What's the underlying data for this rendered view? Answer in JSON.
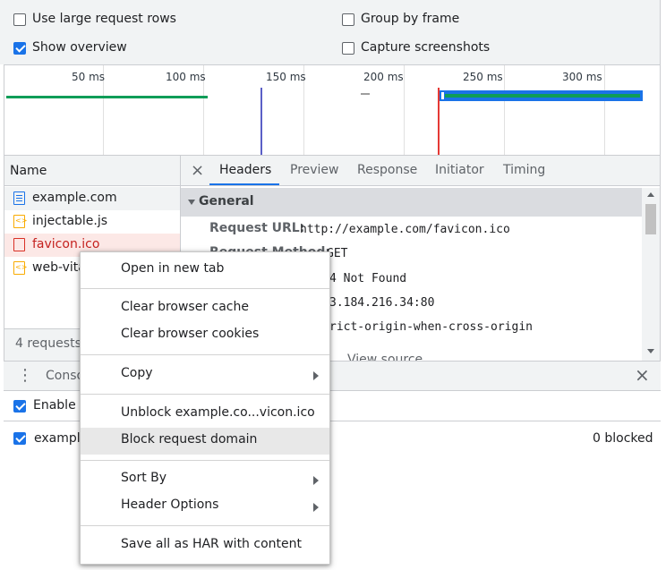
{
  "options": {
    "large_rows": "Use large request rows",
    "group_by_frame": "Group by frame",
    "show_overview": "Show overview",
    "capture_screenshots": "Capture screenshots"
  },
  "overview": {
    "ticks": [
      "50 ms",
      "100 ms",
      "150 ms",
      "200 ms",
      "250 ms",
      "300 ms"
    ]
  },
  "requests": {
    "header": "Name",
    "items": [
      "example.com",
      "injectable.js",
      "favicon.ico",
      "web-vita"
    ],
    "footer": "4 requests"
  },
  "detail": {
    "close": "×",
    "tabs": [
      "Headers",
      "Preview",
      "Response",
      "Initiator",
      "Timing"
    ],
    "general": "General",
    "request_url_key": "Request URL:",
    "request_url": "http://example.com/favicon.ico",
    "request_method_key": "Request Method:",
    "request_method": "GET",
    "status": "4 Not Found",
    "remote": "3.184.216.34:80",
    "referrer": "rict-origin-when-cross-origin",
    "view_source": "View source"
  },
  "drawer": {
    "menu_dots": "⋮",
    "tab": "Conso",
    "close": "×",
    "enable_label": "Enable r",
    "pattern": "example",
    "blocked": "0 blocked"
  },
  "context_menu": {
    "open_new_tab": "Open in new tab",
    "clear_cache": "Clear browser cache",
    "clear_cookies": "Clear browser cookies",
    "copy": "Copy",
    "unblock": "Unblock example.co...vicon.ico",
    "block_domain": "Block request domain",
    "sort_by": "Sort By",
    "header_options": "Header Options",
    "save_har": "Save all as HAR with content"
  },
  "colors": {
    "accent": "#1a73e8",
    "error_row": "#fce8e6",
    "error_text": "#c5221f",
    "waterfall_green": "#0f9d58",
    "dom_line": "#5b5fc7",
    "load_line": "#e53935"
  }
}
